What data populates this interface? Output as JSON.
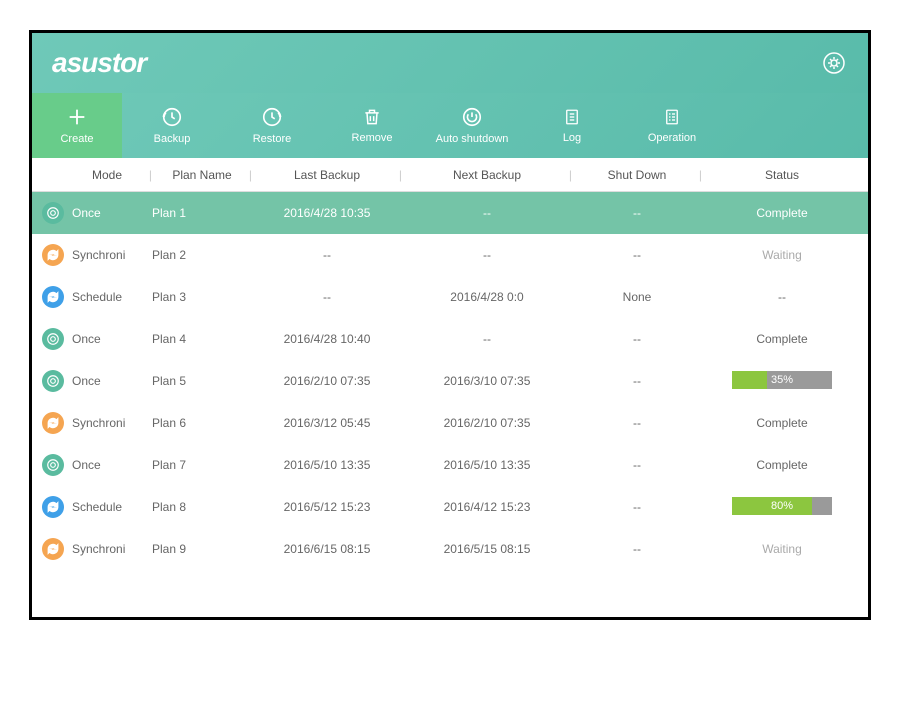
{
  "brand": "asustor",
  "toolbar": {
    "create": "Create",
    "backup": "Backup",
    "restore": "Restore",
    "remove": "Remove",
    "auto_shutdown": "Auto shutdown",
    "log": "Log",
    "operation": "Operation"
  },
  "columns": {
    "mode": "Mode",
    "plan_name": "Plan Name",
    "last_backup": "Last Backup",
    "next_backup": "Next Backup",
    "shut_down": "Shut Down",
    "status": "Status"
  },
  "rows": [
    {
      "mode": "Once",
      "mode_type": "once",
      "plan": "Plan 1",
      "last": "2016/4/28 10:35",
      "next": "--",
      "shut": "--",
      "status": "Complete",
      "status_type": "text",
      "selected": true
    },
    {
      "mode": "Synchroni",
      "mode_type": "synchroni",
      "plan": "Plan 2",
      "last": "--",
      "next": "--",
      "shut": "--",
      "status": "Waiting",
      "status_type": "waiting"
    },
    {
      "mode": "Schedule",
      "mode_type": "schedule",
      "plan": "Plan 3",
      "last": "--",
      "next": "2016/4/28 0:0",
      "shut": "None",
      "status": "--",
      "status_type": "text"
    },
    {
      "mode": "Once",
      "mode_type": "once",
      "plan": "Plan 4",
      "last": "2016/4/28 10:40",
      "next": "--",
      "shut": "--",
      "status": "Complete",
      "status_type": "text"
    },
    {
      "mode": "Once",
      "mode_type": "once",
      "plan": "Plan 5",
      "last": "2016/2/10 07:35",
      "next": "2016/3/10 07:35",
      "shut": "--",
      "status": "35%",
      "status_type": "progress",
      "progress": 35
    },
    {
      "mode": "Synchroni",
      "mode_type": "synchroni",
      "plan": "Plan 6",
      "last": "2016/3/12  05:45",
      "next": "2016/2/10 07:35",
      "shut": "--",
      "status": "Complete",
      "status_type": "text"
    },
    {
      "mode": "Once",
      "mode_type": "once",
      "plan": "Plan 7",
      "last": "2016/5/10 13:35",
      "next": "2016/5/10 13:35",
      "shut": "--",
      "status": "Complete",
      "status_type": "text"
    },
    {
      "mode": "Schedule",
      "mode_type": "schedule",
      "plan": "Plan 8",
      "last": "2016/5/12 15:23",
      "next": "2016/4/12 15:23",
      "shut": "--",
      "status": "80%",
      "status_type": "progress",
      "progress": 80
    },
    {
      "mode": "Synchroni",
      "mode_type": "synchroni",
      "plan": "Plan 9",
      "last": "2016/6/15  08:15",
      "next": "2016/5/15 08:15",
      "shut": "--",
      "status": "Waiting",
      "status_type": "waiting"
    }
  ]
}
